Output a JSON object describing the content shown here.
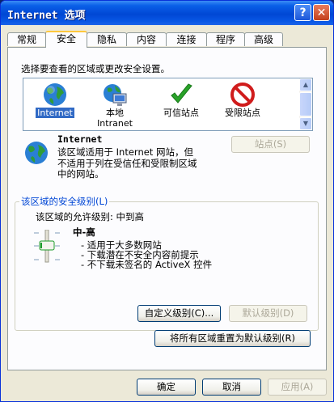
{
  "window": {
    "title": "Internet 选项",
    "help_glyph": "?",
    "close_glyph": "✕"
  },
  "tabs": [
    {
      "label": "常规"
    },
    {
      "label": "安全"
    },
    {
      "label": "隐私"
    },
    {
      "label": "内容"
    },
    {
      "label": "连接"
    },
    {
      "label": "程序"
    },
    {
      "label": "高级"
    }
  ],
  "active_tab": "安全",
  "security": {
    "instruction": "选择要查看的区域或更改安全设置。",
    "zones": [
      {
        "label": "Internet",
        "icon": "globe-icon",
        "selected": true
      },
      {
        "label": "本地\nIntranet",
        "icon": "intranet-icon",
        "selected": false
      },
      {
        "label": "可信站点",
        "icon": "checkmark-icon",
        "selected": false
      },
      {
        "label": "受限站点",
        "icon": "no-entry-icon",
        "selected": false
      }
    ],
    "zone_name": "Internet",
    "zone_description": "该区域适用于 Internet 网站，但\n不适用于列在受信任和受限制区域\n中的网站。",
    "sites_button": "站点(S)",
    "level_group_title": "该区域的安全级别(L)",
    "allowed_levels": "该区域的允许级别: 中到高",
    "level_name": "中-高",
    "level_bullets": [
      "- 适用于大多数网站",
      "- 下载潜在不安全内容前提示",
      "- 不下载未签名的 ActiveX 控件"
    ],
    "custom_level_button": "自定义级别(C)...",
    "default_level_button": "默认级别(D)",
    "reset_all_button": "将所有区域重置为默认级别(R)"
  },
  "footer": {
    "ok": "确定",
    "cancel": "取消",
    "apply": "应用(A)"
  },
  "colors": {
    "titlebar": "#0054e3",
    "face": "#ece9d8",
    "group_title": "#0046d5",
    "selection": "#316ac5"
  }
}
